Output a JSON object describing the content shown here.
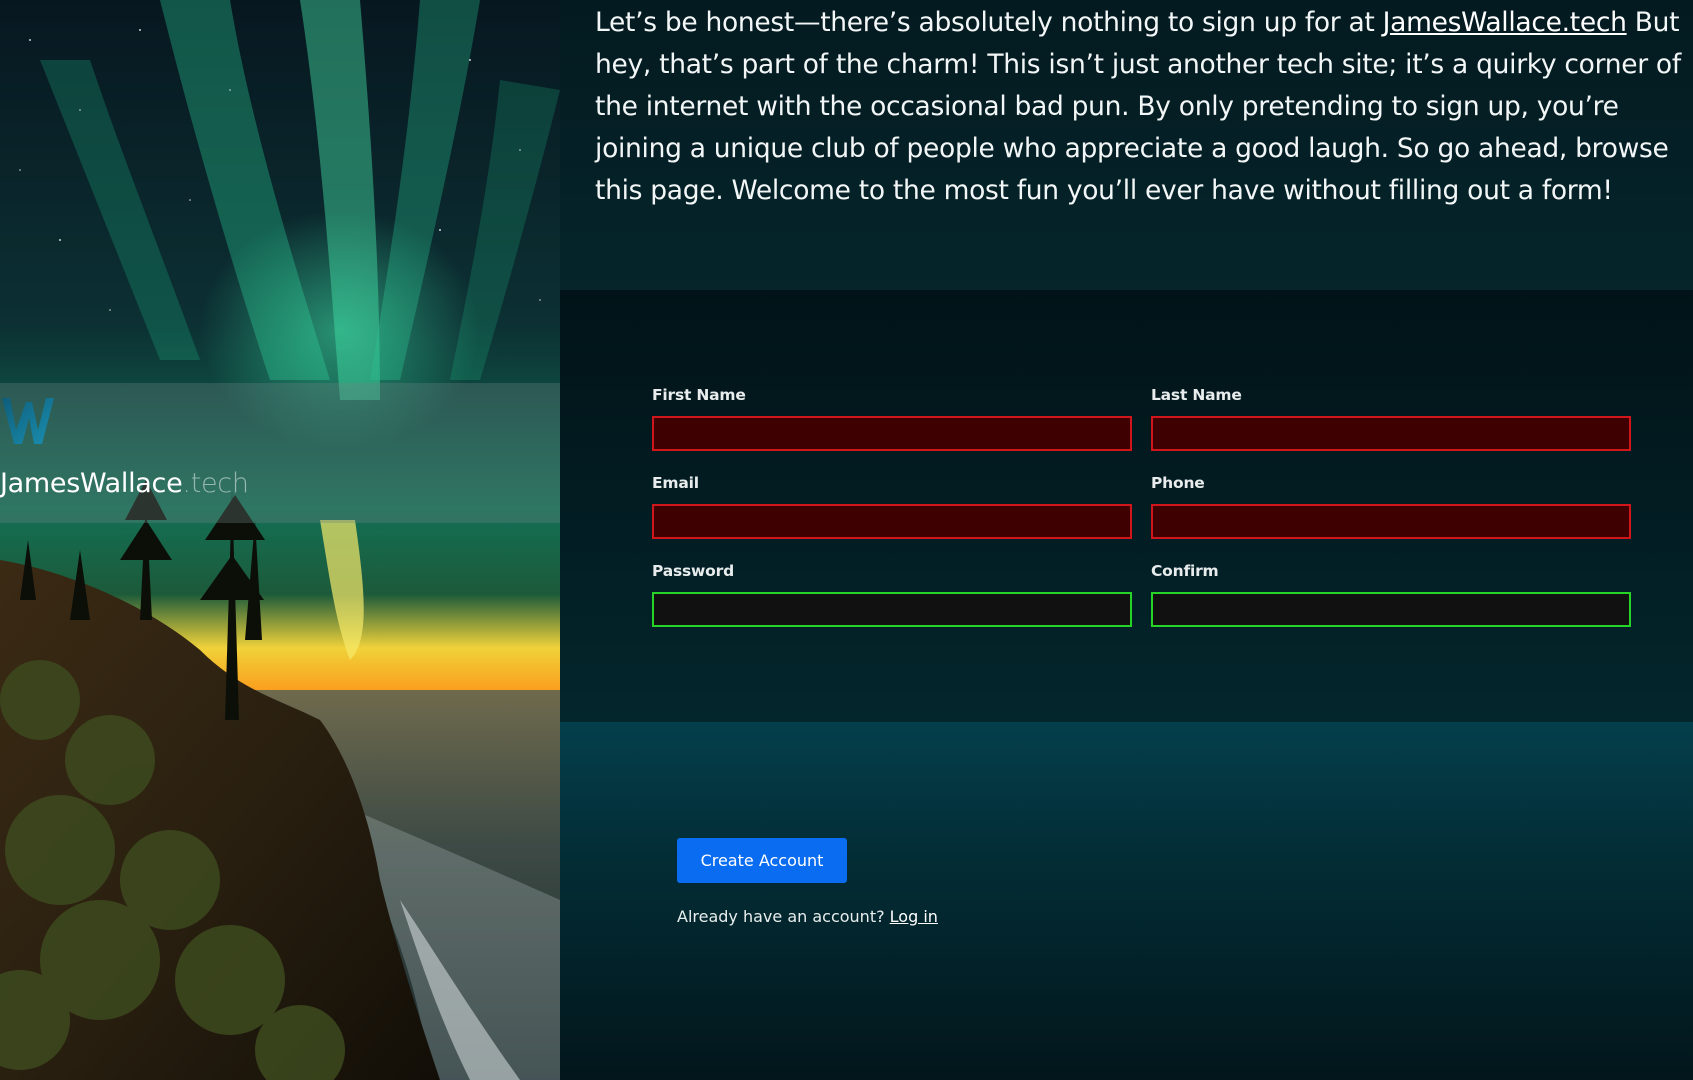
{
  "brand": {
    "logo_letter": "W",
    "name": "JamesWallace",
    "tld": ".tech"
  },
  "intro": {
    "before_link": "Let’s be honest—there’s absolutely nothing to sign up for at ",
    "link_text": "JamesWallace.tech",
    "after_link": " But hey, that’s part of the charm! This isn’t just another tech site; it’s a quirky corner of the internet with the occasional bad pun. By only pretending to sign up, you’re joining a unique club of people who appreciate a good laugh. So go ahead, browse this page. Welcome to the most fun you’ll ever have without filling out a form!"
  },
  "form": {
    "first_name": {
      "label": "First Name",
      "value": "",
      "status": "invalid"
    },
    "last_name": {
      "label": "Last Name",
      "value": "",
      "status": "invalid"
    },
    "email": {
      "label": "Email",
      "value": "",
      "status": "invalid"
    },
    "phone": {
      "label": "Phone",
      "value": "",
      "status": "invalid"
    },
    "password": {
      "label": "Password",
      "value": "",
      "status": "valid"
    },
    "confirm": {
      "label": "Confirm",
      "value": "",
      "status": "valid"
    }
  },
  "actions": {
    "create_label": "Create Account",
    "login_prompt": "Already have an account? ",
    "login_link": "Log in"
  },
  "colors": {
    "invalid_border": "#d0161a",
    "invalid_fill": "#3e0000",
    "valid_border": "#27d327",
    "button": "#0a6cf0"
  }
}
